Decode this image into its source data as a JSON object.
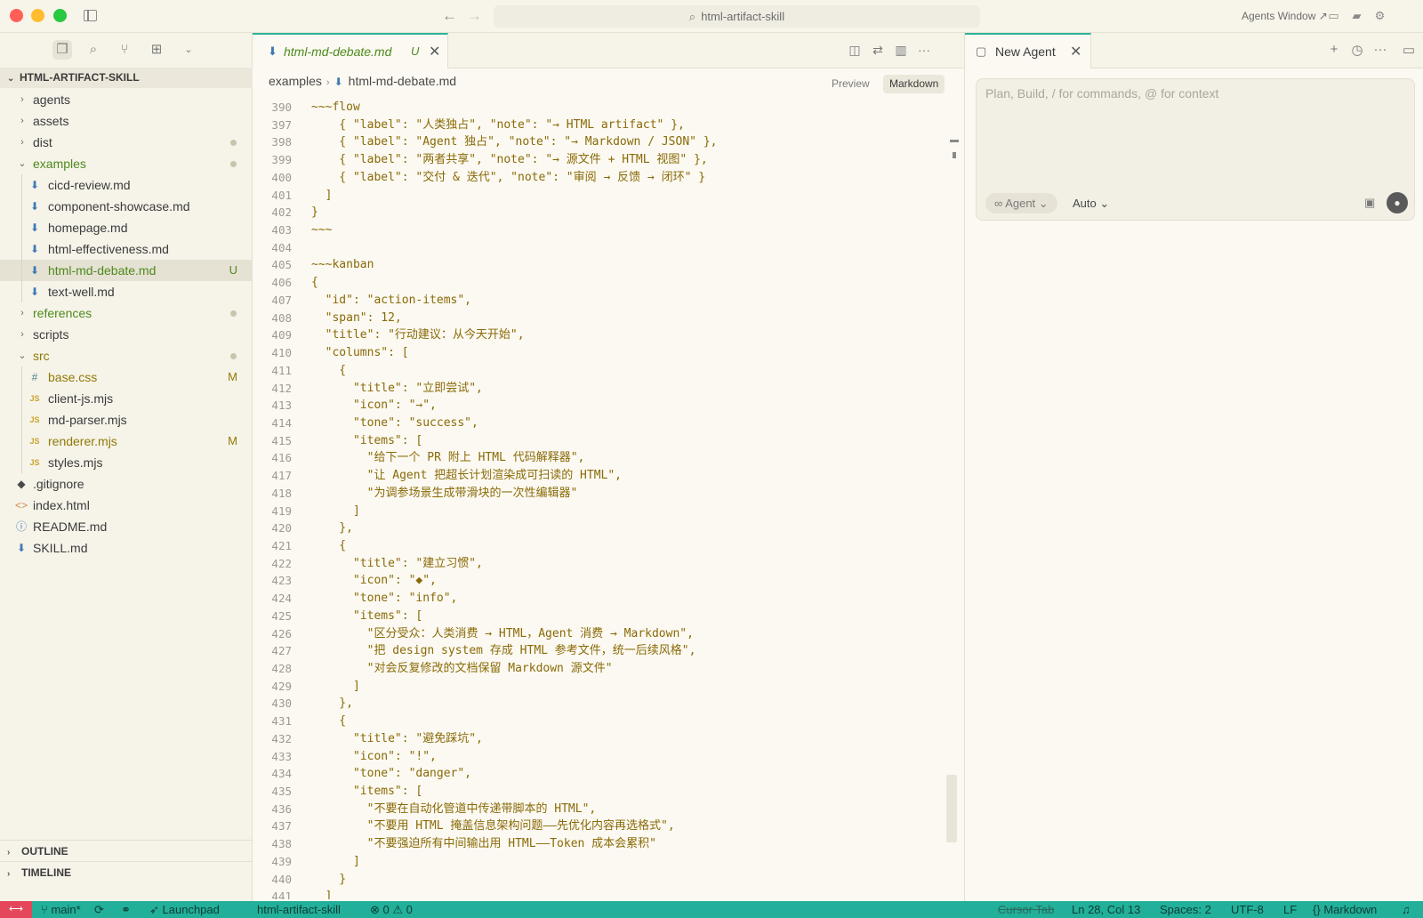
{
  "titlebar": {
    "search_text": "html-artifact-skill",
    "agents_window_label": "Agents Window ↗"
  },
  "sidebar": {
    "root_label": "HTML-ARTIFACT-SKILL",
    "items": [
      {
        "label": "agents",
        "type": "folder",
        "depth": 0,
        "expanded": false
      },
      {
        "label": "assets",
        "type": "folder",
        "depth": 0,
        "expanded": false
      },
      {
        "label": "dist",
        "type": "folder",
        "depth": 0,
        "expanded": false,
        "dot": true
      },
      {
        "label": "examples",
        "type": "folder",
        "depth": 0,
        "expanded": true,
        "color": "green",
        "dot": true
      },
      {
        "label": "cicd-review.md",
        "type": "md",
        "depth": 1
      },
      {
        "label": "component-showcase.md",
        "type": "md",
        "depth": 1
      },
      {
        "label": "homepage.md",
        "type": "md",
        "depth": 1
      },
      {
        "label": "html-effectiveness.md",
        "type": "md",
        "depth": 1
      },
      {
        "label": "html-md-debate.md",
        "type": "md",
        "depth": 1,
        "color": "green",
        "badge": "U",
        "selected": true
      },
      {
        "label": "text-well.md",
        "type": "md",
        "depth": 1
      },
      {
        "label": "references",
        "type": "folder",
        "depth": 0,
        "expanded": false,
        "color": "green",
        "dot": true
      },
      {
        "label": "scripts",
        "type": "folder",
        "depth": 0,
        "expanded": false
      },
      {
        "label": "src",
        "type": "folder",
        "depth": 0,
        "expanded": true,
        "color": "yellow",
        "dot": true
      },
      {
        "label": "base.css",
        "type": "css",
        "depth": 1,
        "color": "yellow",
        "badge": "M"
      },
      {
        "label": "client-js.mjs",
        "type": "js",
        "depth": 1
      },
      {
        "label": "md-parser.mjs",
        "type": "js",
        "depth": 1
      },
      {
        "label": "renderer.mjs",
        "type": "js",
        "depth": 1,
        "color": "yellow",
        "badge": "M"
      },
      {
        "label": "styles.mjs",
        "type": "js",
        "depth": 1
      },
      {
        "label": ".gitignore",
        "type": "git",
        "depth": 0
      },
      {
        "label": "index.html",
        "type": "html",
        "depth": 0
      },
      {
        "label": "README.md",
        "type": "info",
        "depth": 0
      },
      {
        "label": "SKILL.md",
        "type": "md",
        "depth": 0
      }
    ],
    "outline_label": "OUTLINE",
    "timeline_label": "TIMELINE"
  },
  "editor": {
    "tab": {
      "name": "html-md-debate.md",
      "status": "U"
    },
    "breadcrumb": [
      "examples",
      "html-md-debate.md"
    ],
    "view_preview": "Preview",
    "view_markdown": "Markdown",
    "lines": [
      {
        "n": "390",
        "t": "~~~flow"
      },
      {
        "n": "397",
        "t": "    { \"label\": \"人类独占\", \"note\": \"→ HTML artifact\" },"
      },
      {
        "n": "398",
        "t": "    { \"label\": \"Agent 独占\", \"note\": \"→ Markdown / JSON\" },"
      },
      {
        "n": "399",
        "t": "    { \"label\": \"两者共享\", \"note\": \"→ 源文件 + HTML 视图\" },"
      },
      {
        "n": "400",
        "t": "    { \"label\": \"交付 & 迭代\", \"note\": \"审阅 → 反馈 → 闭环\" }"
      },
      {
        "n": "401",
        "t": "  ]"
      },
      {
        "n": "402",
        "t": "}"
      },
      {
        "n": "403",
        "t": "~~~"
      },
      {
        "n": "404",
        "t": ""
      },
      {
        "n": "405",
        "t": "~~~kanban"
      },
      {
        "n": "406",
        "t": "{"
      },
      {
        "n": "407",
        "t": "  \"id\": \"action-items\","
      },
      {
        "n": "408",
        "t": "  \"span\": 12,"
      },
      {
        "n": "409",
        "t": "  \"title\": \"行动建议：从今天开始\","
      },
      {
        "n": "410",
        "t": "  \"columns\": ["
      },
      {
        "n": "411",
        "t": "    {"
      },
      {
        "n": "412",
        "t": "      \"title\": \"立即尝试\","
      },
      {
        "n": "413",
        "t": "      \"icon\": \"→\","
      },
      {
        "n": "414",
        "t": "      \"tone\": \"success\","
      },
      {
        "n": "415",
        "t": "      \"items\": ["
      },
      {
        "n": "416",
        "t": "        \"给下一个 PR 附上 HTML 代码解释器\","
      },
      {
        "n": "417",
        "t": "        \"让 Agent 把超长计划渲染成可扫读的 HTML\","
      },
      {
        "n": "418",
        "t": "        \"为调参场景生成带滑块的一次性编辑器\""
      },
      {
        "n": "419",
        "t": "      ]"
      },
      {
        "n": "420",
        "t": "    },"
      },
      {
        "n": "421",
        "t": "    {"
      },
      {
        "n": "422",
        "t": "      \"title\": \"建立习惯\","
      },
      {
        "n": "423",
        "t": "      \"icon\": \"◆\","
      },
      {
        "n": "424",
        "t": "      \"tone\": \"info\","
      },
      {
        "n": "425",
        "t": "      \"items\": ["
      },
      {
        "n": "426",
        "t": "        \"区分受众：人类消费 → HTML，Agent 消费 → Markdown\","
      },
      {
        "n": "427",
        "t": "        \"把 design system 存成 HTML 参考文件，统一后续风格\","
      },
      {
        "n": "428",
        "t": "        \"对会反复修改的文档保留 Markdown 源文件\""
      },
      {
        "n": "429",
        "t": "      ]"
      },
      {
        "n": "430",
        "t": "    },"
      },
      {
        "n": "431",
        "t": "    {"
      },
      {
        "n": "432",
        "t": "      \"title\": \"避免踩坑\","
      },
      {
        "n": "433",
        "t": "      \"icon\": \"!\","
      },
      {
        "n": "434",
        "t": "      \"tone\": \"danger\","
      },
      {
        "n": "435",
        "t": "      \"items\": ["
      },
      {
        "n": "436",
        "t": "        \"不要在自动化管道中传递带脚本的 HTML\","
      },
      {
        "n": "437",
        "t": "        \"不要用 HTML 掩盖信息架构问题——先优化内容再选格式\","
      },
      {
        "n": "438",
        "t": "        \"不要强迫所有中间输出用 HTML——Token 成本会累积\""
      },
      {
        "n": "439",
        "t": "      ]"
      },
      {
        "n": "440",
        "t": "    }"
      },
      {
        "n": "441",
        "t": "  ]"
      }
    ]
  },
  "agent": {
    "tab_label": "New Agent",
    "placeholder": "Plan, Build, / for commands, @ for context",
    "mode_label": "Agent",
    "model_label": "Auto"
  },
  "statusbar": {
    "branch": "main*",
    "launchpad": "Launchpad",
    "workspace": "html-artifact-skill",
    "problems": "⊗ 0 ⚠ 0",
    "cursor_tab": "Cursor Tab",
    "position": "Ln 28, Col 13",
    "spaces": "Spaces: 2",
    "encoding": "UTF-8",
    "eol": "LF",
    "language": "Markdown"
  },
  "colors": {
    "accent": "#22b09a",
    "string": "#8a6a08",
    "untracked": "#4e8a1c",
    "modified": "#8f7a07"
  }
}
